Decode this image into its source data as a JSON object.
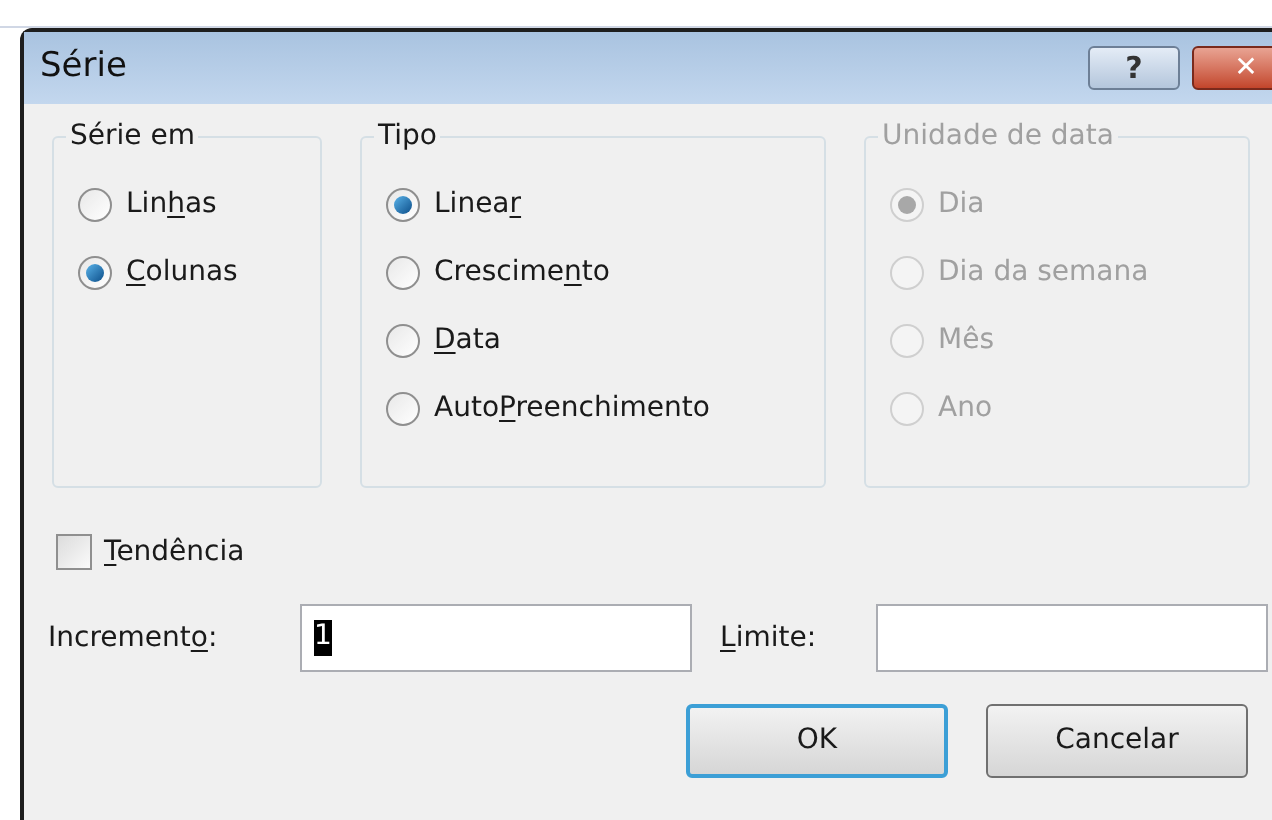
{
  "window": {
    "title": "Série",
    "help_button": "?",
    "close_button": "✕"
  },
  "groups": [
    {
      "title": "Série em",
      "disabled": false,
      "options": [
        {
          "label": {
            "before": "Lin",
            "key": "h",
            "after": "as"
          },
          "selected": false
        },
        {
          "label": {
            "key": "C",
            "after": "olunas"
          },
          "selected": true
        }
      ]
    },
    {
      "title": "Tipo",
      "disabled": false,
      "options": [
        {
          "label": {
            "before": "Linea",
            "key": "r"
          },
          "selected": true
        },
        {
          "label": {
            "before": "Crescime",
            "key": "n",
            "after": "to"
          },
          "selected": false
        },
        {
          "label": {
            "key": "D",
            "after": "ata"
          },
          "selected": false
        },
        {
          "label": {
            "before": "Auto",
            "key": "P",
            "after": "reenchimento"
          },
          "selected": false
        }
      ]
    },
    {
      "title": "Unidade de data",
      "disabled": true,
      "options": [
        {
          "label": {
            "before": "Dia"
          },
          "selected": true
        },
        {
          "label": {
            "before": "Dia da semana"
          },
          "selected": false
        },
        {
          "label": {
            "before": "Mês"
          },
          "selected": false
        },
        {
          "label": {
            "before": "Ano"
          },
          "selected": false
        }
      ]
    }
  ],
  "trend": {
    "label": {
      "key": "T",
      "after": "endência"
    },
    "checked": false
  },
  "fields": [
    {
      "label": {
        "before": "Increment",
        "key": "o",
        "after": ":"
      },
      "value": "1"
    },
    {
      "label": {
        "key": "L",
        "after": "imite:"
      }
    }
  ],
  "buttons": [
    {
      "label": "OK",
      "default": true
    },
    {
      "label": "Cancelar",
      "default": false
    }
  ]
}
